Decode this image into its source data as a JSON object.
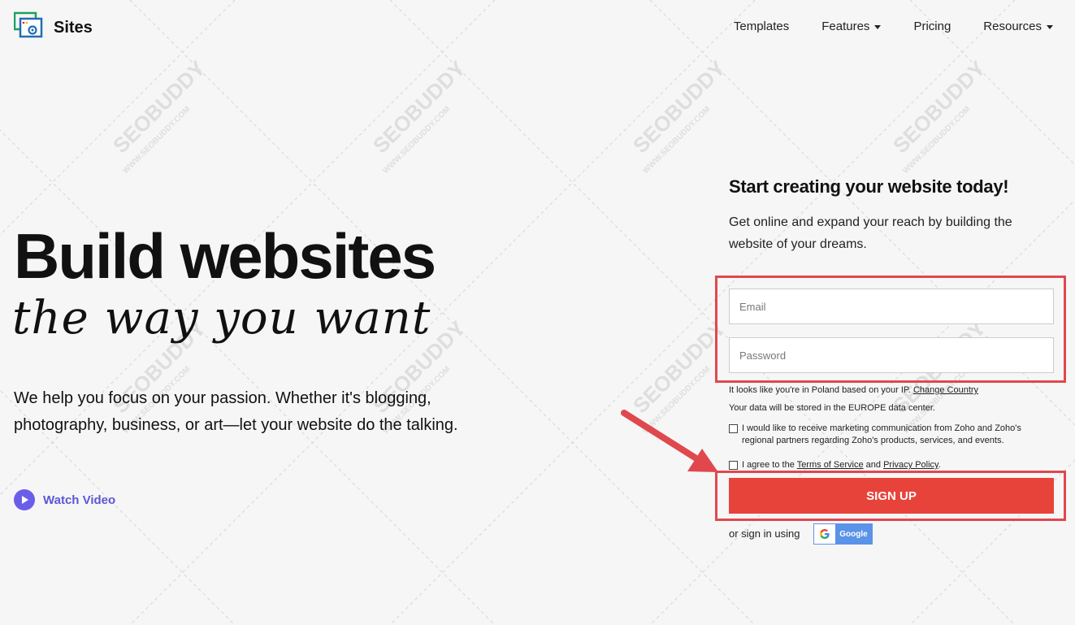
{
  "header": {
    "logo_text": "Sites",
    "nav": [
      {
        "label": "Templates"
      },
      {
        "label": "Features"
      },
      {
        "label": "Pricing"
      },
      {
        "label": "Resources"
      }
    ]
  },
  "hero": {
    "title": "Build websites",
    "script": "the way you want",
    "description": "We help you focus on your passion. Whether it's blogging, photography, business, or art—let your website do the talking.",
    "watch_video": "Watch Video"
  },
  "signup": {
    "title": "Start creating your website today!",
    "subtitle": "Get online and expand your reach by building the website of your dreams.",
    "email_placeholder": "Email",
    "password_placeholder": "Password",
    "ip_note": "It looks like you're in Poland based on your IP.",
    "change_country": "Change Country",
    "data_note": "Your data will be stored in the EUROPE data center.",
    "marketing_consent": "I would like to receive marketing communication from Zoho and Zoho's regional partners regarding Zoho's products, services, and events.",
    "terms_prefix": "I agree to the",
    "terms_link": "Terms of Service",
    "terms_and": "and",
    "privacy_link": "Privacy Policy",
    "terms_suffix": ".",
    "button": "SIGN UP",
    "or_sign_in": "or sign in using",
    "google": "Google"
  },
  "watermark": {
    "brand": "SEOBUDDY",
    "url": "WWW.SEOBUDDY.COM"
  },
  "colors": {
    "accent_red": "#e8433b",
    "highlight_red": "#e0484e",
    "video_purple": "#6a5ee8",
    "google_blue": "#5a93e8"
  },
  "icons": {
    "logo": "sites-logo-icon",
    "play": "play-icon",
    "caret": "caret-down-icon",
    "google": "google-g-icon",
    "arrow": "red-arrow-annotation"
  }
}
